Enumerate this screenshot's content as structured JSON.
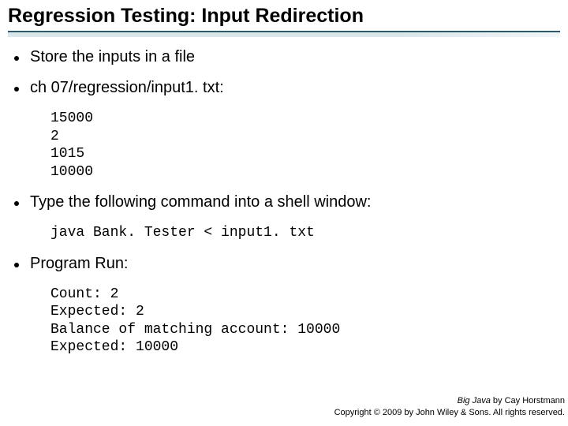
{
  "title": "Regression Testing: Input Redirection",
  "bullets": {
    "b1": "Store the inputs in a file",
    "b2": "ch 07/regression/input1. txt:",
    "b3": "Type the following command into a shell window:",
    "b4": "Program Run:"
  },
  "code": {
    "input_file": "15000\n2\n1015\n10000",
    "command": "java Bank. Tester < input1. txt",
    "output": "Count: 2\nExpected: 2\nBalance of matching account: 10000\nExpected: 10000"
  },
  "footer": {
    "book": "Big Java",
    "author": " by Cay Horstmann",
    "copyright": "Copyright © 2009 by John Wiley & Sons. All rights reserved."
  }
}
